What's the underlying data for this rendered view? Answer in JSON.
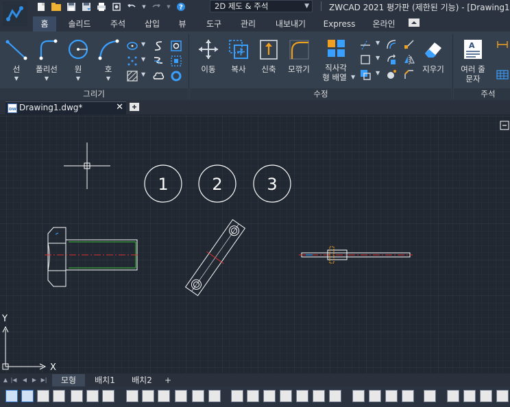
{
  "window": {
    "title": "ZWCAD 2021 평가판 (제한된 기능) - [Drawing1.d",
    "workspace": "2D 제도 & 주석"
  },
  "ribbon_tabs": [
    {
      "label": "홈"
    },
    {
      "label": "솔리드"
    },
    {
      "label": "주석"
    },
    {
      "label": "삽입"
    },
    {
      "label": "뷰"
    },
    {
      "label": "도구"
    },
    {
      "label": "관리"
    },
    {
      "label": "내보내기"
    },
    {
      "label": "Express"
    },
    {
      "label": "온라인"
    }
  ],
  "ribbon": {
    "draw_group": {
      "title": "그리기",
      "line": "선",
      "polyline": "폴리선",
      "circle": "원",
      "arc": "호"
    },
    "modify_group": {
      "title": "수정",
      "move": "이동",
      "copy": "복사",
      "stretch": "신축",
      "fillet": "모깎기",
      "array_line1": "직사각",
      "array_line2": "형 배열",
      "erase": "지우기"
    },
    "annotation_group": {
      "title": "주석",
      "mtext_line1": "여러 줄",
      "mtext_line2": "문자"
    }
  },
  "document_tab": {
    "label": "Drawing1.dwg*"
  },
  "drawing": {
    "balloons": [
      "1",
      "2",
      "3"
    ],
    "ucs_x": "X",
    "ucs_y": "Y"
  },
  "layout_tabs": [
    {
      "label": "모형",
      "active": true
    },
    {
      "label": "배치1",
      "active": false
    },
    {
      "label": "배치2",
      "active": false
    },
    {
      "label": "+",
      "active": false
    }
  ],
  "colors": {
    "accent": "#3a4b63",
    "canvas": "#212832",
    "centerline": "#e0312f",
    "thread": "#3cbf3c",
    "highlight": "#f0a020"
  }
}
